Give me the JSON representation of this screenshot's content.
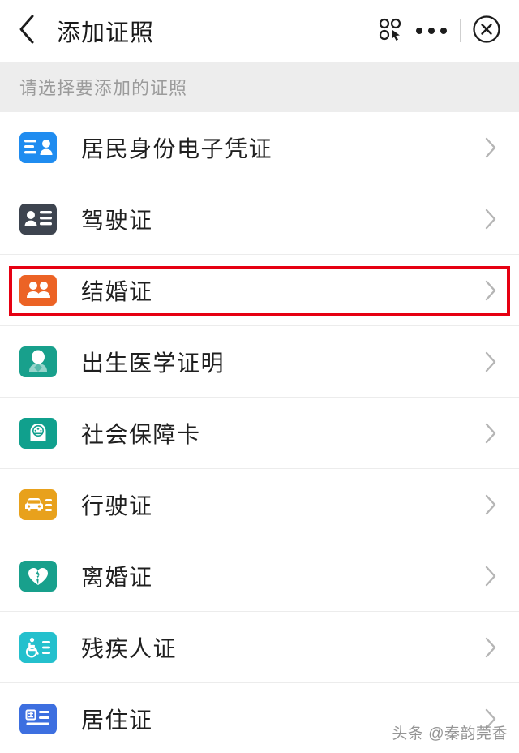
{
  "header": {
    "title": "添加证照",
    "back_icon": "chevron-left-icon",
    "mini_program_icon": "mini-program-menu-icon",
    "more_icon": "more-dots-icon",
    "close_icon": "close-circle-icon"
  },
  "section": {
    "label": "请选择要添加的证照"
  },
  "list": {
    "items": [
      {
        "label": "居民身份电子凭证",
        "icon": "id-card-icon",
        "icon_color": "#1f8cf0",
        "chevron": "chevron-right-icon",
        "highlighted": false
      },
      {
        "label": "驾驶证",
        "icon": "driver-license-icon",
        "icon_color": "#3d444f",
        "chevron": "chevron-right-icon",
        "highlighted": false
      },
      {
        "label": "结婚证",
        "icon": "couple-icon",
        "icon_color": "#ec6325",
        "chevron": "chevron-right-icon",
        "highlighted": true
      },
      {
        "label": "出生医学证明",
        "icon": "baby-icon",
        "icon_color": "#18a08c",
        "chevron": "chevron-right-icon",
        "highlighted": false
      },
      {
        "label": "社会保障卡",
        "icon": "social-security-emblem-icon",
        "icon_color": "#10a08d",
        "chevron": "chevron-right-icon",
        "highlighted": false
      },
      {
        "label": "行驶证",
        "icon": "vehicle-license-icon",
        "icon_color": "#e8a11c",
        "chevron": "chevron-right-icon",
        "highlighted": false
      },
      {
        "label": "离婚证",
        "icon": "broken-heart-icon",
        "icon_color": "#18a08c",
        "chevron": "chevron-right-icon",
        "highlighted": false
      },
      {
        "label": "残疾人证",
        "icon": "wheelchair-icon",
        "icon_color": "#24c0cd",
        "chevron": "chevron-right-icon",
        "highlighted": false
      },
      {
        "label": "居住证",
        "icon": "residence-permit-icon",
        "icon_color": "#3d6fe0",
        "chevron": "chevron-right-icon",
        "highlighted": false
      }
    ]
  },
  "highlight": {
    "color": "#e60012"
  },
  "watermark": {
    "text": "头条 @秦韵莞香"
  }
}
